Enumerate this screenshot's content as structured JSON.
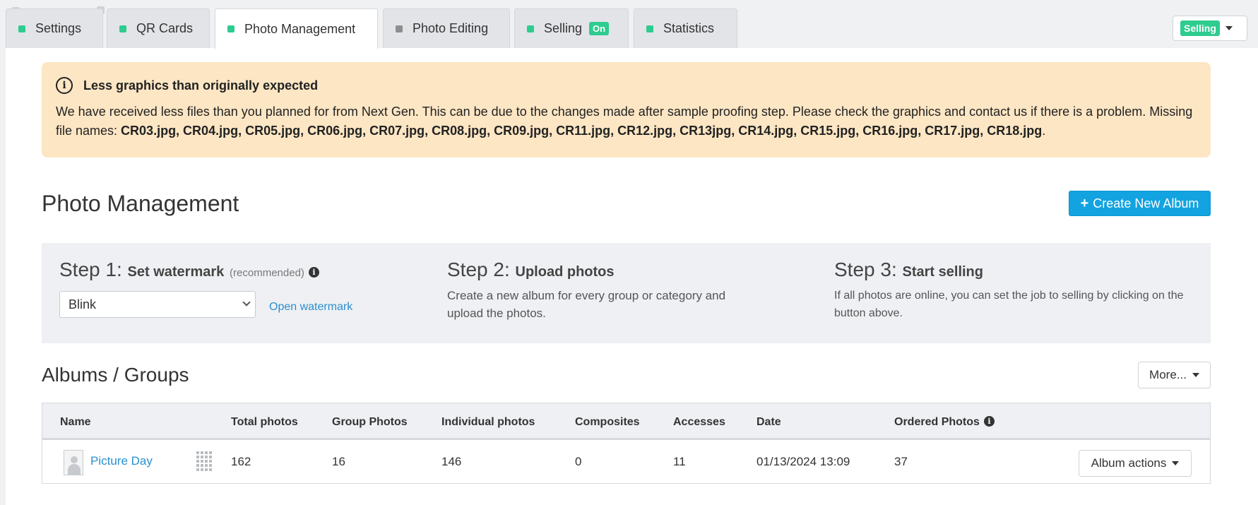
{
  "tabs": [
    {
      "label": "Settings",
      "status": "green"
    },
    {
      "label": "QR Cards",
      "status": "green"
    },
    {
      "label": "Photo Management",
      "status": "green",
      "active": true
    },
    {
      "label": "Photo Editing",
      "status": "gray"
    },
    {
      "label": "Selling",
      "status": "green",
      "badge": "On"
    },
    {
      "label": "Statistics",
      "status": "green"
    }
  ],
  "selling_dropdown": {
    "label": "Selling"
  },
  "alert": {
    "title": "Less graphics than originally expected",
    "body": "We have received less files than you planned for from Next Gen. This can be due to the changes made after sample proofing step. Please check the graphics and contact us if there is a problem. Missing file names: ",
    "missing_files": "CR03.jpg, CR04.jpg, CR05.jpg, CR06.jpg, CR07.jpg, CR08.jpg, CR09.jpg, CR11.jpg, CR12.jpg, CR13jpg, CR14.jpg, CR15.jpg, CR16.jpg, CR17.jpg, CR18.jpg",
    "end": "."
  },
  "page_title": "Photo Management",
  "create_button": "Create New Album",
  "steps": [
    {
      "num": "Step 1:",
      "title": "Set watermark",
      "note": "(recommended)"
    },
    {
      "num": "Step 2:",
      "title": "Upload photos",
      "text": "Create a new album for every group or category and upload the photos."
    },
    {
      "num": "Step 3:",
      "title": "Start selling",
      "text": "If all photos are online, you can set the job to selling by clicking on the button above."
    }
  ],
  "watermark": {
    "selected": "Blink",
    "link": "Open watermark"
  },
  "albums": {
    "title": "Albums / Groups",
    "more_button": "More...",
    "columns": [
      "Name",
      "Total photos",
      "Group Photos",
      "Individual photos",
      "Composites",
      "Accesses",
      "Date",
      "Ordered Photos"
    ],
    "rows": [
      {
        "name": "Picture Day",
        "total": "162",
        "group": "16",
        "individual": "146",
        "composites": "0",
        "accesses": "11",
        "date": "01/13/2024 13:09",
        "ordered": "37",
        "action": "Album actions"
      }
    ]
  }
}
